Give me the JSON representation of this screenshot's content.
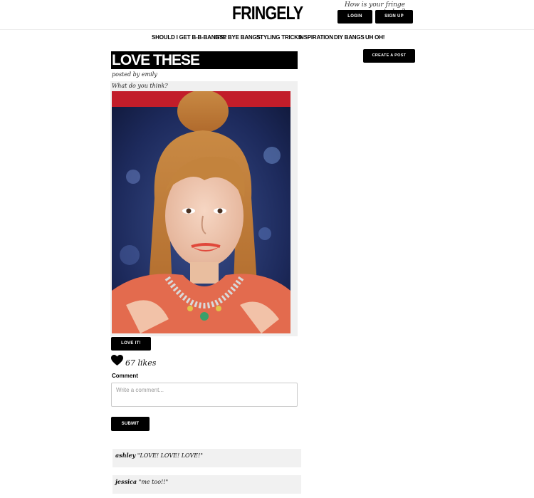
{
  "header": {
    "logo": "FRINGELY",
    "tagline": "How is your fringe today?",
    "login_label": "LOGIN",
    "signup_label": "SIGN UP"
  },
  "nav": {
    "items": [
      {
        "label": "SHOULD I GET B-B-BANGS?"
      },
      {
        "label": "BYE BYE BANGS"
      },
      {
        "label": "STYLING TRICKS"
      },
      {
        "label": "INSPIRATION"
      },
      {
        "label": "DIY BANGS"
      },
      {
        "label": "UH OH!"
      }
    ]
  },
  "sidebar": {
    "create_post_label": "CREATE A POST"
  },
  "post": {
    "title": "LOVE THESE",
    "posted_by": "posted by emily",
    "question": "What do you think?",
    "love_label": "LOVE IT!",
    "likes": "67 likes"
  },
  "comment_form": {
    "label": "Comment",
    "placeholder": "Write a comment...",
    "submit_label": "SUBMIT"
  },
  "comments": [
    {
      "author": "ashley",
      "text": "\"LOVE! LOVE! LOVE!\""
    },
    {
      "author": "jessica",
      "text": "\"me too!!\""
    }
  ],
  "colors": {
    "accent": "#000000",
    "comment_bg": "#f1f1f1",
    "post_bg": "#f0f0f0"
  }
}
